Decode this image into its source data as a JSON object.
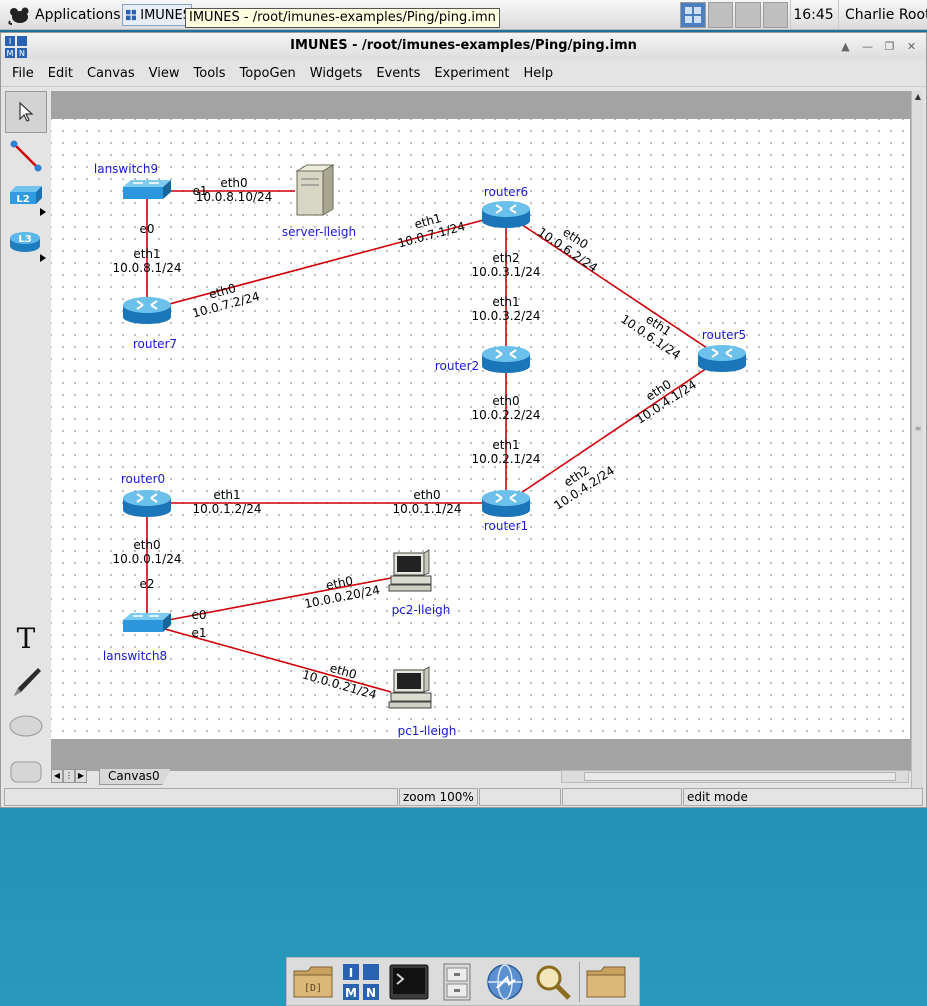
{
  "top_panel": {
    "applications_label": "Applications",
    "task_label": "IMUNES",
    "tooltip": "IMUNES - /root/imunes-examples/Ping/ping.imn",
    "clock": "16:45",
    "user": "Charlie Root"
  },
  "window": {
    "title": "IMUNES - /root/imunes-examples/Ping/ping.imn",
    "menu": [
      "File",
      "Edit",
      "Canvas",
      "View",
      "Tools",
      "TopoGen",
      "Widgets",
      "Events",
      "Experiment",
      "Help"
    ],
    "tools": [
      {
        "name": "select-tool",
        "icon": "pointer-arrow-icon"
      },
      {
        "name": "link-tool",
        "icon": "link-icon"
      },
      {
        "name": "l2-tool",
        "icon": "l2-switch-icon",
        "label": "L2"
      },
      {
        "name": "l3-tool",
        "icon": "l3-router-icon",
        "label": "L3"
      },
      {
        "name": "text-tool",
        "icon": "text-icon",
        "label": "T"
      },
      {
        "name": "freeform-tool",
        "icon": "pen-icon"
      },
      {
        "name": "oval-tool",
        "icon": "oval-icon"
      },
      {
        "name": "rectangle-tool",
        "icon": "rectangle-icon"
      }
    ],
    "canvas_tab": "Canvas0",
    "status": {
      "zoom": "zoom 100%",
      "mode": "edit mode"
    }
  },
  "topology": {
    "nodes": [
      {
        "name": "lanswitch9",
        "type": "switch"
      },
      {
        "name": "server-lleigh",
        "type": "server"
      },
      {
        "name": "router6",
        "type": "router"
      },
      {
        "name": "router7",
        "type": "router"
      },
      {
        "name": "router2",
        "type": "router"
      },
      {
        "name": "router5",
        "type": "router"
      },
      {
        "name": "router0",
        "type": "router"
      },
      {
        "name": "router1",
        "type": "router"
      },
      {
        "name": "lanswitch8",
        "type": "switch"
      },
      {
        "name": "pc2-lleigh",
        "type": "pc"
      },
      {
        "name": "pc1-lleigh",
        "type": "pc"
      }
    ],
    "links": [
      {
        "a": "lanswitch9",
        "b": "server-lleigh",
        "a_iface": "e1",
        "b_iface": "eth0",
        "b_addr": "10.0.8.10/24"
      },
      {
        "a": "lanswitch9",
        "b": "router7",
        "a_iface": "e0",
        "b_iface": "eth1",
        "b_addr": "10.0.8.1/24"
      },
      {
        "a": "router7",
        "b": "router6",
        "a_iface": "eth0",
        "a_addr": "10.0.7.2/24",
        "b_iface": "eth1",
        "b_addr": "10.0.7.1/24"
      },
      {
        "a": "router6",
        "b": "router2",
        "a_iface": "eth2",
        "a_addr": "10.0.3.1/24",
        "b_iface": "eth1",
        "b_addr": "10.0.3.2/24"
      },
      {
        "a": "router6",
        "b": "router5",
        "a_iface": "eth0",
        "a_addr": "10.0.6.2/24",
        "b_iface": "eth1",
        "b_addr": "10.0.6.1/24"
      },
      {
        "a": "router2",
        "b": "router1",
        "a_iface": "eth0",
        "a_addr": "10.0.2.2/24",
        "b_iface": "eth1",
        "b_addr": "10.0.2.1/24"
      },
      {
        "a": "router5",
        "b": "router1",
        "a_iface": "eth0",
        "a_addr": "10.0.4.1/24",
        "b_iface": "eth2",
        "b_addr": "10.0.4.2/24"
      },
      {
        "a": "router0",
        "b": "router1",
        "a_iface": "eth1",
        "a_addr": "10.0.1.2/24",
        "b_iface": "eth0",
        "b_addr": "10.0.1.1/24"
      },
      {
        "a": "router0",
        "b": "lanswitch8",
        "a_iface": "eth0",
        "a_addr": "10.0.0.1/24",
        "b_iface": "e2"
      },
      {
        "a": "lanswitch8",
        "b": "pc2-lleigh",
        "a_iface": "e0",
        "b_iface": "eth0",
        "b_addr": "10.0.0.20/24"
      },
      {
        "a": "lanswitch8",
        "b": "pc1-lleigh",
        "a_iface": "e1",
        "b_iface": "eth0",
        "b_addr": "10.0.0.21/24"
      }
    ]
  },
  "dock": [
    {
      "name": "dock-home-folder",
      "icon": "folder-icon"
    },
    {
      "name": "dock-imunes",
      "icon": "imunes-icon"
    },
    {
      "name": "dock-terminal",
      "icon": "terminal-icon"
    },
    {
      "name": "dock-file-cabinet",
      "icon": "cabinet-icon"
    },
    {
      "name": "dock-browser",
      "icon": "globe-icon"
    },
    {
      "name": "dock-search",
      "icon": "magnifier-icon"
    },
    {
      "name": "dock-folder",
      "icon": "folder-icon"
    }
  ]
}
